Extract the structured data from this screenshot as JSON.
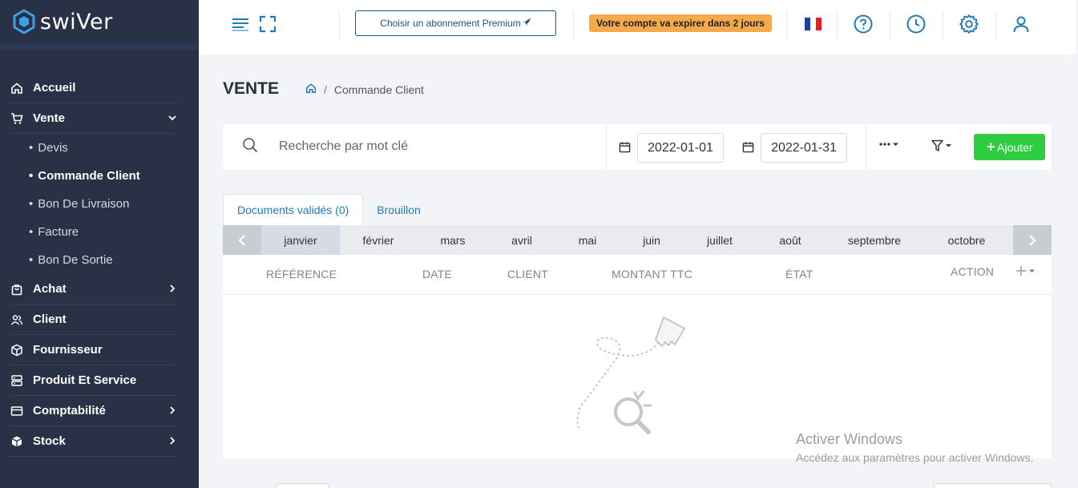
{
  "app": {
    "brand": "swiVer"
  },
  "sidebar": {
    "items": [
      {
        "label": "Accueil",
        "icon": "home-icon"
      },
      {
        "label": "Vente",
        "icon": "cart-icon",
        "expanded": true,
        "children": [
          {
            "label": "Devis"
          },
          {
            "label": "Commande Client",
            "active": true
          },
          {
            "label": "Bon De Livraison"
          },
          {
            "label": "Facture"
          },
          {
            "label": "Bon De Sortie"
          }
        ]
      },
      {
        "label": "Achat",
        "icon": "bag-icon"
      },
      {
        "label": "Client",
        "icon": "users-icon"
      },
      {
        "label": "Fournisseur",
        "icon": "box-icon"
      },
      {
        "label": "Produit Et Service",
        "icon": "server-icon"
      },
      {
        "label": "Comptabilité",
        "icon": "card-icon"
      },
      {
        "label": "Stock",
        "icon": "cube-icon"
      }
    ]
  },
  "topbar": {
    "premium_label": "Choisir un abonnement Premium",
    "expire_label": "Votre compte va expirer dans 2 jours"
  },
  "page": {
    "title": "VENTE",
    "breadcrumb": "Commande Client"
  },
  "filters": {
    "search_placeholder": "Recherche par mot clé",
    "date_from": "2022-01-01",
    "date_to": "2022-01-31",
    "add_label": "Ajouter"
  },
  "tabs": [
    {
      "label": "Documents validés (0)",
      "active": true
    },
    {
      "label": "Brouillon"
    }
  ],
  "months": [
    "janvier",
    "février",
    "mars",
    "avril",
    "mai",
    "juin",
    "juillet",
    "août",
    "septembre",
    "octobre"
  ],
  "table": {
    "columns": [
      "RÉFÉRENCE",
      "DATE",
      "CLIENT",
      "MONTANT TTC",
      "ÉTAT",
      "ACTION"
    ]
  },
  "watermark": {
    "title": "Activer Windows",
    "subtitle": "Accédez aux paramètres pour activer Windows."
  },
  "colors": {
    "sidebar_bg": "#283145",
    "accent_blue": "#1f7ab8",
    "add_green": "#2ecc40",
    "badge_orange": "#f6a94a"
  }
}
